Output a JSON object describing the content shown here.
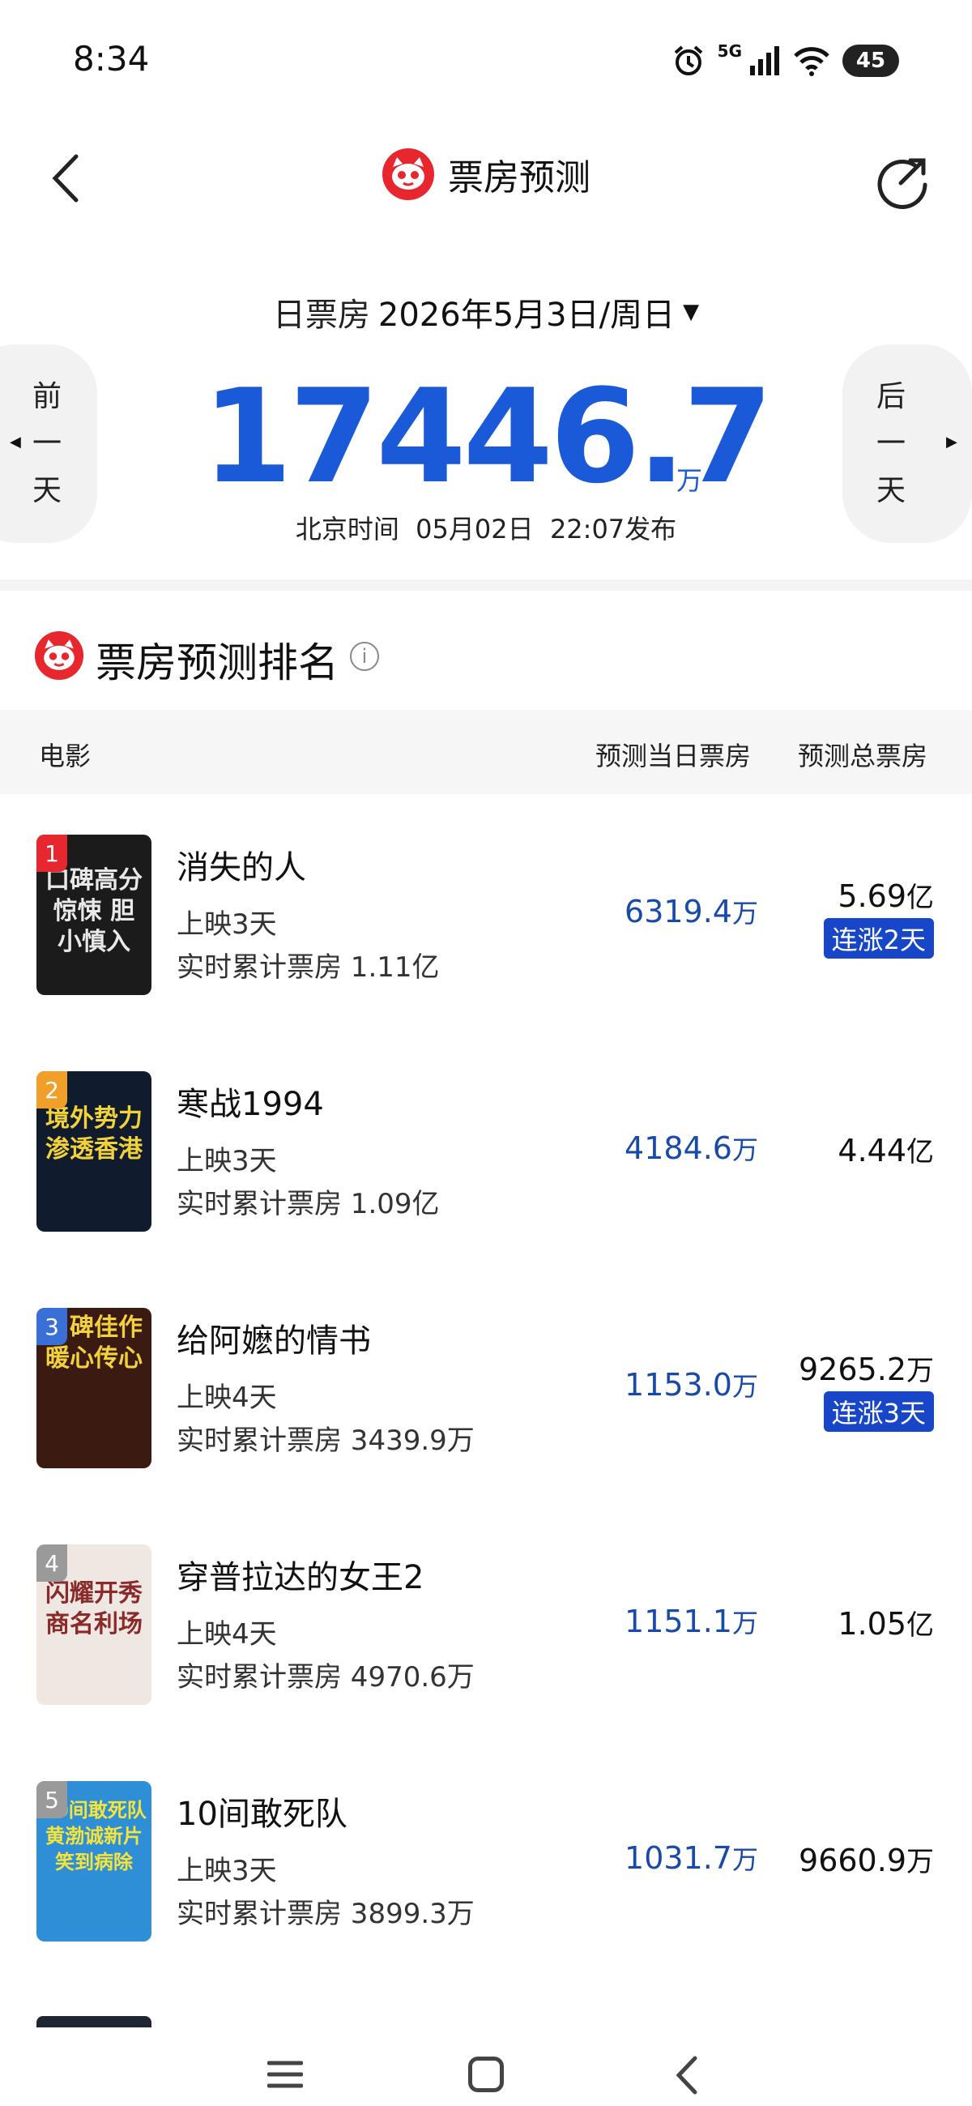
{
  "status_bar": {
    "time": "8:34",
    "network": "5G",
    "battery": "45"
  },
  "header": {
    "title": "票房预测"
  },
  "date_selector": {
    "label": "日票房",
    "date": "2026年5月3日/周日",
    "caret": "▼"
  },
  "box_office": {
    "value": "17446.7",
    "unit": "万",
    "publish_note": "北京时间  05月02日  22:07发布"
  },
  "nav": {
    "prev": [
      "前",
      "一",
      "天"
    ],
    "next": [
      "后",
      "一",
      "天"
    ]
  },
  "ranking": {
    "title": "票房预测排名",
    "columns": {
      "movie": "电影",
      "day": "预测当日票房",
      "total": "预测总票房"
    },
    "movies": [
      {
        "rank": "1",
        "name": "消失的人",
        "days": "上映3天",
        "cumulative": "实时累计票房 1.11亿",
        "day_value": "6319.4",
        "day_unit": "万",
        "total_value": "5.69",
        "total_unit": "亿",
        "badge": "连涨2天",
        "poster_text": "口碑高分 惊悚 胆小慎入",
        "rank_color": "#e8262d",
        "poster_color": "#1b1b1b"
      },
      {
        "rank": "2",
        "name": "寒战1994",
        "days": "上映3天",
        "cumulative": "实时累计票房 1.09亿",
        "day_value": "4184.6",
        "day_unit": "万",
        "total_value": "4.44",
        "total_unit": "亿",
        "badge": "",
        "poster_text": "境外势力 渗透香港",
        "rank_color": "#f0a028",
        "poster_color": "#101c2e"
      },
      {
        "rank": "3",
        "name": "给阿嬷的情书",
        "days": "上映4天",
        "cumulative": "实时累计票房 3439.9万",
        "day_value": "1153.0",
        "day_unit": "万",
        "total_value": "9265.2",
        "total_unit": "万",
        "badge": "连涨3天",
        "poster_text": "口碑佳作 暖心传心",
        "rank_color": "#3a6fd8",
        "poster_color": "#3b1a12"
      },
      {
        "rank": "4",
        "name": "穿普拉达的女王2",
        "days": "上映4天",
        "cumulative": "实时累计票房 4970.6万",
        "day_value": "1151.1",
        "day_unit": "万",
        "total_value": "1.05",
        "total_unit": "亿",
        "badge": "",
        "poster_text": "闪耀开秀 商名利场",
        "rank_color": "#9a9a9a",
        "poster_color": "#efe8e2"
      },
      {
        "rank": "5",
        "name": "10间敢死队",
        "days": "上映3天",
        "cumulative": "实时累计票房 3899.3万",
        "day_value": "1031.7",
        "day_unit": "万",
        "total_value": "9660.9",
        "total_unit": "万",
        "badge": "",
        "poster_text": "10间敢死队 黄渤诚新片 笑到病除",
        "rank_color": "#9a9a9a",
        "poster_color": "#2e8fd6"
      }
    ]
  },
  "icons": {
    "back": "back-arrow-icon",
    "share": "share-icon",
    "logo": "cat-logo-icon",
    "info": "info-icon"
  },
  "colors": {
    "accent": "#1a5ad8",
    "badge": "#1747c8",
    "brand_red": "#e8262d"
  }
}
